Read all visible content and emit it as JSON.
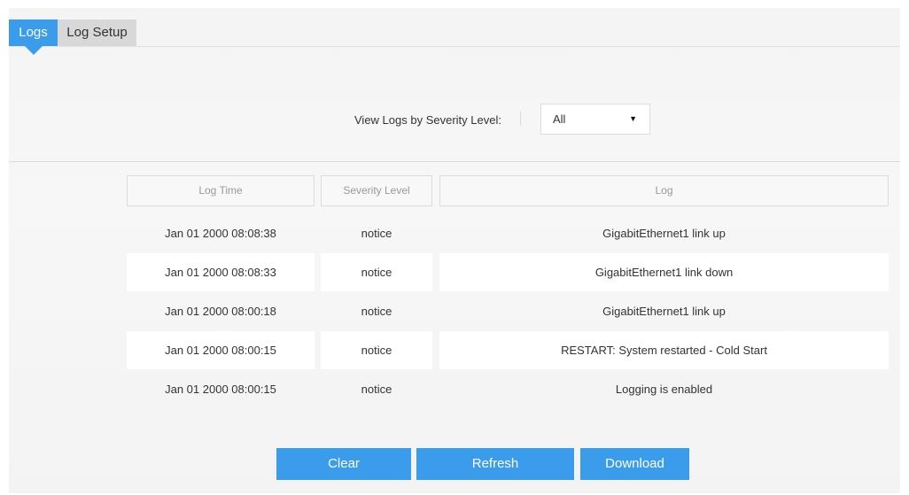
{
  "tabs": [
    {
      "label": "Logs",
      "active": true
    },
    {
      "label": "Log Setup",
      "active": false
    }
  ],
  "filter": {
    "label": "View Logs by Severity Level:",
    "selected": "All"
  },
  "table": {
    "headers": [
      "Log Time",
      "Severity Level",
      "Log"
    ],
    "rows": [
      {
        "time": "Jan 01 2000 08:08:38",
        "severity": "notice",
        "log": "GigabitEthernet1 link up"
      },
      {
        "time": "Jan 01 2000 08:08:33",
        "severity": "notice",
        "log": "GigabitEthernet1 link down"
      },
      {
        "time": "Jan 01 2000 08:00:18",
        "severity": "notice",
        "log": "GigabitEthernet1 link up"
      },
      {
        "time": "Jan 01 2000 08:00:15",
        "severity": "notice",
        "log": "RESTART: System restarted - Cold Start"
      },
      {
        "time": "Jan 01 2000 08:00:15",
        "severity": "notice",
        "log": "Logging is enabled"
      }
    ]
  },
  "buttons": {
    "clear": "Clear",
    "refresh": "Refresh",
    "download": "Download"
  },
  "colors": {
    "accent": "#3b9cec",
    "inactive_tab": "#d8d8d8"
  }
}
